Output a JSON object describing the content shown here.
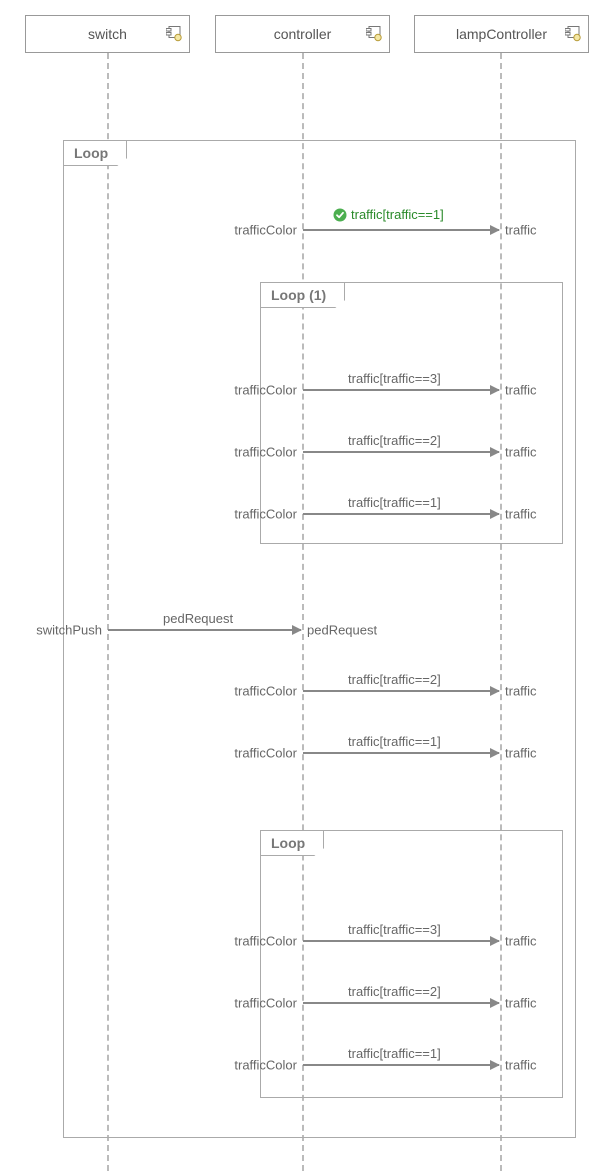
{
  "lifelines": {
    "switch": {
      "label": "switch"
    },
    "controller": {
      "label": "controller"
    },
    "lampController": {
      "label": "lampController"
    }
  },
  "fragments": {
    "outer": {
      "label": "Loop"
    },
    "inner1": {
      "label": "Loop (1)"
    },
    "inner2": {
      "label": "Loop"
    }
  },
  "messages": {
    "m1": {
      "guard": "traffic[traffic==1]",
      "in": "trafficColor",
      "out": "traffic"
    },
    "m2": {
      "guard": "traffic[traffic==3]",
      "in": "trafficColor",
      "out": "traffic"
    },
    "m3": {
      "guard": "traffic[traffic==2]",
      "in": "trafficColor",
      "out": "traffic"
    },
    "m4": {
      "guard": "traffic[traffic==1]",
      "in": "trafficColor",
      "out": "traffic"
    },
    "m5": {
      "guard": "pedRequest",
      "in": "switchPush",
      "out": "pedRequest"
    },
    "m6": {
      "guard": "traffic[traffic==2]",
      "in": "trafficColor",
      "out": "traffic"
    },
    "m7": {
      "guard": "traffic[traffic==1]",
      "in": "trafficColor",
      "out": "traffic"
    },
    "m8": {
      "guard": "traffic[traffic==3]",
      "in": "trafficColor",
      "out": "traffic"
    },
    "m9": {
      "guard": "traffic[traffic==2]",
      "in": "trafficColor",
      "out": "traffic"
    },
    "m10": {
      "guard": "traffic[traffic==1]",
      "in": "trafficColor",
      "out": "traffic"
    }
  }
}
